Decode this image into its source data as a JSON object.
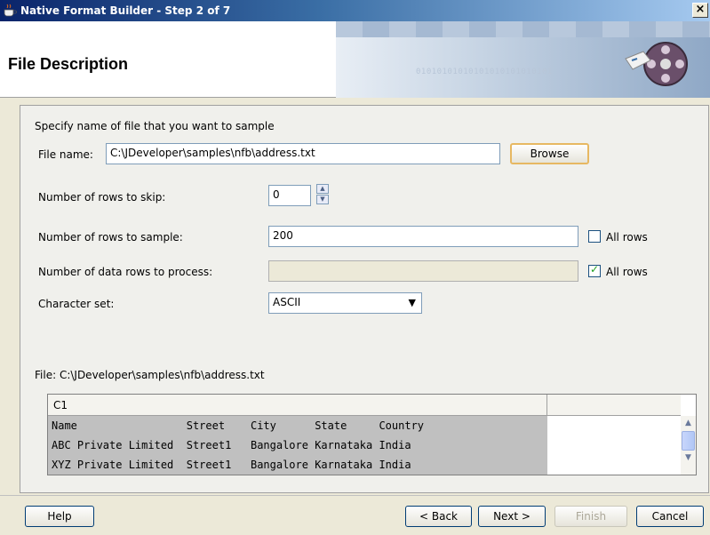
{
  "window": {
    "title": "Native Format Builder - Step 2 of 7",
    "close_label": "×"
  },
  "header": {
    "title": "File Description",
    "binary_text": "01010101010101010101010101"
  },
  "form": {
    "instruction": "Specify name of file that you want to sample",
    "file_name_label": "File name:",
    "file_name_value": "C:\\JDeveloper\\samples\\nfb\\address.txt",
    "browse_label": "Browse",
    "rows_skip_label": "Number of rows to skip:",
    "rows_skip_value": "0",
    "rows_sample_label": "Number of rows to sample:",
    "rows_sample_value": "200",
    "rows_sample_all_checked": false,
    "rows_process_label": "Number of data rows to process:",
    "rows_process_value": "",
    "rows_process_all_checked": true,
    "all_rows_label": "All rows",
    "charset_label": "Character set:",
    "charset_value": "ASCII"
  },
  "preview": {
    "file_label": "File: C:\\JDeveloper\\samples\\nfb\\address.txt",
    "column_header": "C1",
    "rows": [
      "Name                 Street    City      State     Country",
      "ABC Private Limited  Street1   Bangalore Karnataka India",
      "XYZ Private Limited  Street1   Bangalore Karnataka India"
    ]
  },
  "footer": {
    "help_label": "Help",
    "back_label": "< Back",
    "next_label": "Next >",
    "finish_label": "Finish",
    "cancel_label": "Cancel"
  },
  "colors": {
    "title_gradient_start": "#0a246a",
    "dialog_bg": "#ece9d8",
    "focus_border": "#e7b862"
  }
}
